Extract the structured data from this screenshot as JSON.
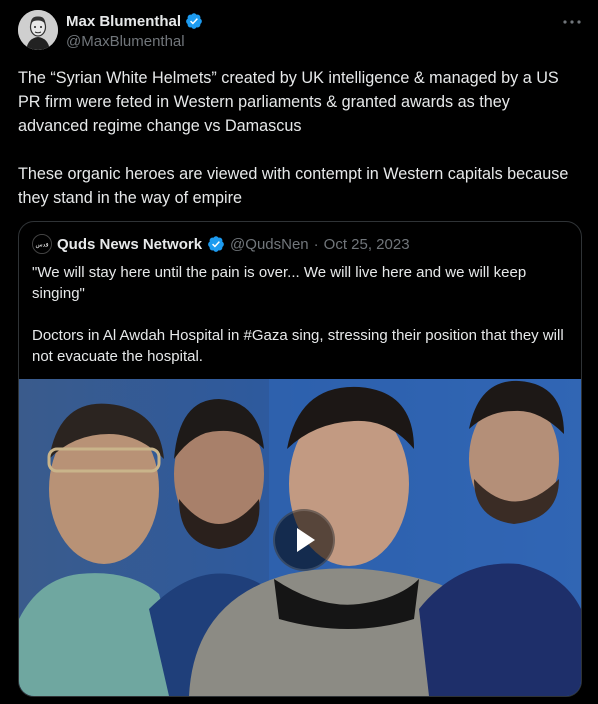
{
  "author": {
    "name": "Max Blumenthal",
    "handle": "@MaxBlumenthal"
  },
  "tweet_text": "The “Syrian White Helmets” created by UK intelligence & managed by a US PR firm were feted in Western parliaments & granted awards as they advanced regime change vs Damascus\n\nThese organic heroes are viewed with contempt in Western capitals because they stand in the way of empire",
  "quoted": {
    "name": "Quds News Network",
    "handle": "@QudsNen",
    "separator": "·",
    "date": "Oct 25, 2023",
    "logo_text": "قدس",
    "text": "\"We will stay here until the pain is over... We will live here and we will keep singing\"\n\nDoctors in Al Awdah Hospital in #Gaza sing, stressing their position that they will not evacuate the hospital."
  },
  "icons": {
    "verified": "verified-badge-icon",
    "more": "more-options-icon",
    "play": "play-icon"
  },
  "colors": {
    "background": "#000000",
    "text": "#e7e9ea",
    "muted": "#71767b",
    "verified": "#1d9bf0",
    "border": "#2f3336"
  }
}
